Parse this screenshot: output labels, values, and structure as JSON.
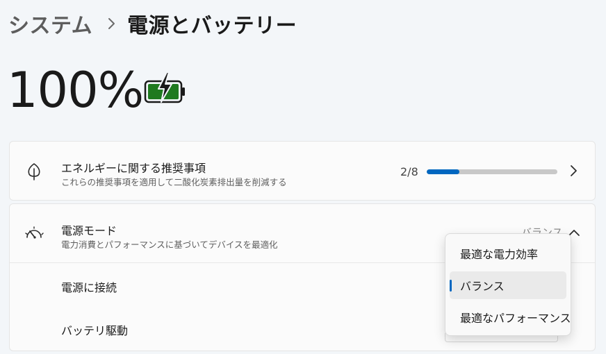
{
  "breadcrumb": {
    "parent": "システム",
    "current": "電源とバッテリー"
  },
  "battery": {
    "percent_label": "100%",
    "charging": true,
    "level_fraction": 1.0,
    "fill_color": "#1f7a1f"
  },
  "recommendations": {
    "title": "エネルギーに関する推奨事項",
    "subtitle": "これらの推奨事項を適用して二酸化炭素排出量を削減する",
    "progress_label": "2/8",
    "progress_fraction": 0.25,
    "icon": "leaf-icon"
  },
  "power_mode": {
    "title": "電源モード",
    "subtitle": "電力消費とパフォーマンスに基づいてデバイスを最適化",
    "current_value": "バランス",
    "icon": "speedometer-icon",
    "rows": [
      {
        "label": "電源に接続"
      },
      {
        "label": "バッテリ駆動"
      }
    ]
  },
  "dropdown": {
    "options": [
      {
        "label": "最適な電力効率"
      },
      {
        "label": "バランス"
      },
      {
        "label": "最適なパフォーマンス"
      }
    ],
    "selected_index": 1
  },
  "colors": {
    "accent": "#0067c0",
    "background": "#f3f6f9",
    "card": "#fbfbfb"
  }
}
